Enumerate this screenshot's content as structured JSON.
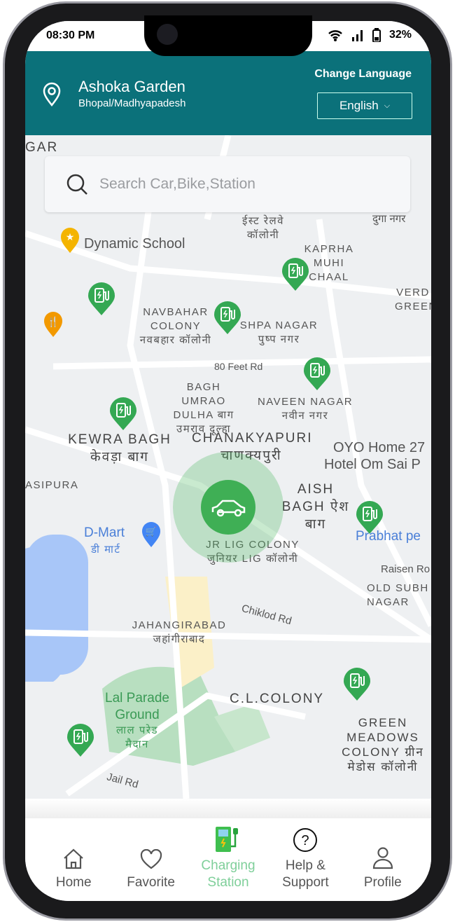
{
  "status": {
    "time": "08:30 PM",
    "battery": "32%"
  },
  "header": {
    "location_title": "Ashoka Garden",
    "location_sub": "Bhopal/Madhyapadesh",
    "change_language": "Change Language",
    "language": "English"
  },
  "search": {
    "placeholder": "Search Car,Bike,Station"
  },
  "map": {
    "labels": [
      "GAR",
      "Dynamic School",
      "ईस्ट रेलवे कॉलोनी",
      "KAPRHA MUHI CHAAL",
      "NAVBAHAR COLONY नवबहार कॉलोनी",
      "SHPA NAGAR पुष्प नगर",
      "80 Feet Rd",
      "BAGH UMRAO DULHA बाग उमराव दूल्हा",
      "NAVEEN NAGAR नवीन नगर",
      "KEWRA BAGH केवड़ा बाग",
      "CHANAKYAPURI चाणक्यपुरी",
      "OYO Home 27",
      "Hotel Om Sai P",
      "AISH BAGH ऐश बाग",
      "ASIPURA",
      "D-Mart",
      "डी मार्ट",
      "JR LIG COLONY जुनियर LIG कॉलोनी",
      "Prabhat pe",
      "Raisen Ro",
      "OLD SUBH NAGAR",
      "JAHANGIRABAD जहांगीराबाद",
      "Chiklod Rd",
      "Lal Parade Ground",
      "लाल परेड मैदान",
      "C.L.COLONY",
      "GREEN MEADOWS COLONY ग्रीन मेडोस कॉलोनी",
      "Jail Rd",
      "दुगा नगर",
      "VERD GREEN"
    ]
  },
  "colors": {
    "header": "#0b717a",
    "accent": "#3faf55",
    "active_nav": "#7fcf9a"
  },
  "nav": [
    {
      "label": "Home",
      "icon": "home-icon"
    },
    {
      "label": "Favorite",
      "icon": "heart-icon"
    },
    {
      "label": "Charging Station",
      "icon": "charging-station-icon",
      "active": true
    },
    {
      "label": "Help & Support",
      "icon": "help-icon"
    },
    {
      "label": "Profile",
      "icon": "profile-icon"
    }
  ]
}
